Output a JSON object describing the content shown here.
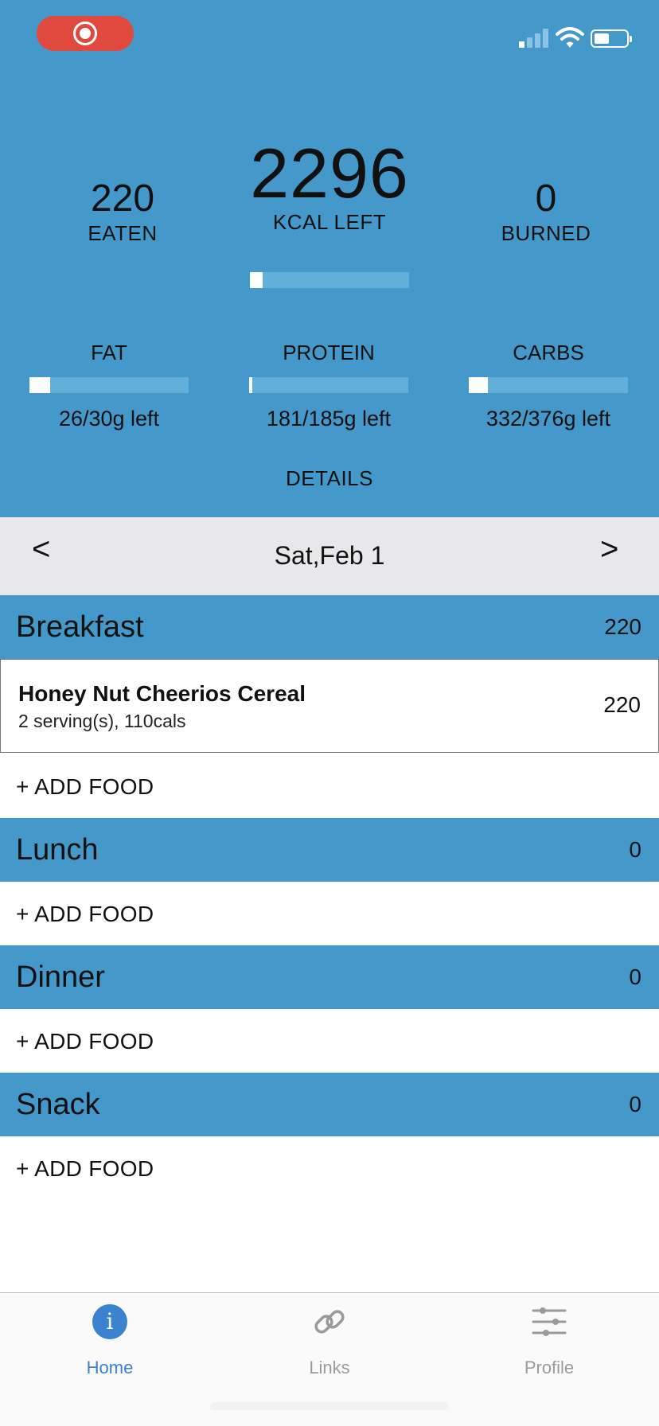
{
  "colors": {
    "header_blue": "#4598ca",
    "bar_track": "#62afd9",
    "record_red": "#e2493e",
    "active_tab": "#3b82cf",
    "inactive_tab": "#9a9a9a"
  },
  "status_bar": {
    "icons": [
      "screen-record-icon",
      "cellular-signal-icon",
      "wifi-icon",
      "battery-icon"
    ]
  },
  "summary": {
    "eaten": {
      "value": "220",
      "label": "EATEN"
    },
    "kcal_left": {
      "value": "2296",
      "label": "KCAL LEFT",
      "progress": 0.08
    },
    "burned": {
      "value": "0",
      "label": "BURNED"
    },
    "macros": [
      {
        "label": "FAT",
        "value_text": "26/30g left",
        "progress": 0.13
      },
      {
        "label": "PROTEIN",
        "value_text": "181/185g left",
        "progress": 0.02
      },
      {
        "label": "CARBS",
        "value_text": "332/376g left",
        "progress": 0.12
      }
    ],
    "details_label": "DETAILS"
  },
  "date_nav": {
    "prev_label": "<",
    "date": "Sat,Feb 1",
    "next_label": ">"
  },
  "meals": [
    {
      "name": "Breakfast",
      "calories": "220",
      "items": [
        {
          "name": "Honey Nut Cheerios Cereal",
          "detail": "2 serving(s), 110cals",
          "calories": "220"
        }
      ],
      "add_label": "+ ADD FOOD"
    },
    {
      "name": "Lunch",
      "calories": "0",
      "items": [],
      "add_label": "+ ADD FOOD"
    },
    {
      "name": "Dinner",
      "calories": "0",
      "items": [],
      "add_label": "+ ADD FOOD"
    },
    {
      "name": "Snack",
      "calories": "0",
      "items": [],
      "add_label": "+ ADD FOOD"
    }
  ],
  "tab_bar": {
    "tabs": [
      {
        "label": "Home",
        "icon": "info-circle-icon",
        "active": true
      },
      {
        "label": "Links",
        "icon": "link-icon",
        "active": false
      },
      {
        "label": "Profile",
        "icon": "sliders-icon",
        "active": false
      }
    ]
  }
}
